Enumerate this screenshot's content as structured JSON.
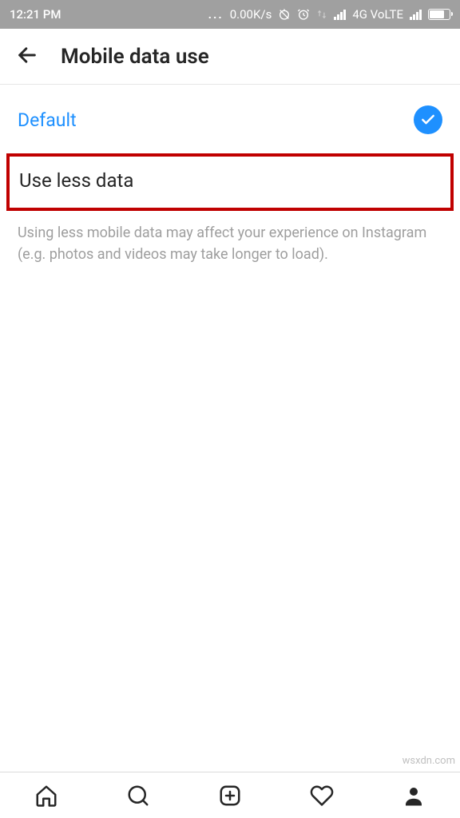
{
  "status_bar": {
    "time": "12:21 PM",
    "data_speed": "0.00K/s",
    "network_label": "4G VoLTE"
  },
  "header": {
    "title": "Mobile data use"
  },
  "options": {
    "default_label": "Default",
    "use_less_data_label": "Use less data"
  },
  "description_text": "Using less mobile data may affect your experience on Instagram (e.g. photos and videos may take longer to load).",
  "watermark": "wsxdn.com"
}
